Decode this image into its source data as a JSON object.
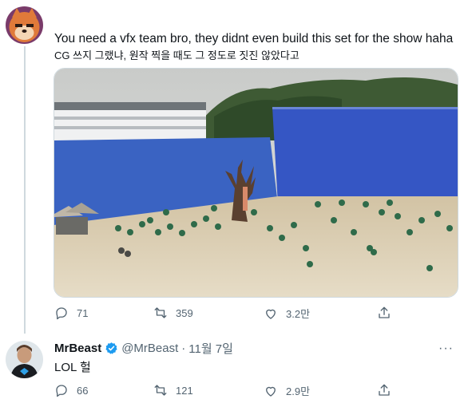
{
  "original_tweet": {
    "text_en": "You need a vfx team bro, they didnt even build this set for the show haha",
    "text_ko": "CG 쓰지 그랬냐, 원작 찍을 때도 그 정도로 짓진 않았다고",
    "media": {
      "description": "photo"
    },
    "actions": {
      "reply_count": "71",
      "retweet_count": "359",
      "like_count": "3.2만"
    }
  },
  "reply_tweet": {
    "display_name": "MrBeast",
    "handle": "@MrBeast",
    "separator": "·",
    "date": "11월 7일",
    "text": "LOL 헐",
    "more_label": "···",
    "actions": {
      "reply_count": "66",
      "retweet_count": "121",
      "like_count": "2.9만"
    }
  },
  "icons": {
    "reply": "reply-icon",
    "retweet": "retweet-icon",
    "like": "heart-icon",
    "share": "share-icon",
    "verified": "verified-badge-icon"
  },
  "colors": {
    "text": "#0f1419",
    "secondary": "#536471",
    "verified": "#1d9bf0",
    "divider": "#cfd9de"
  }
}
